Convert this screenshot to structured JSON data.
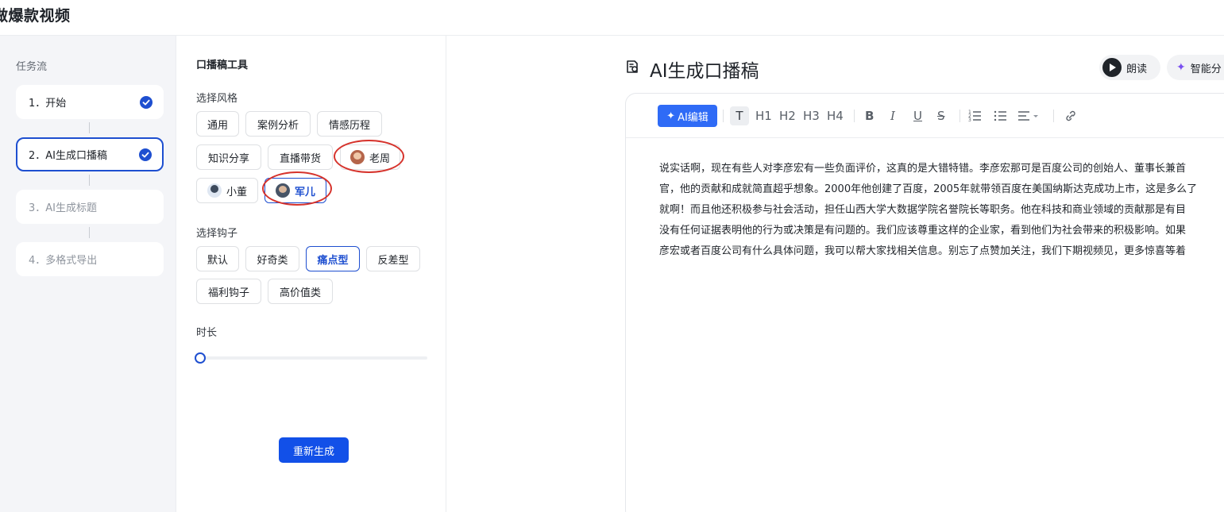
{
  "header": {
    "title": "做爆款视频"
  },
  "taskflow": {
    "title": "任务流",
    "steps": [
      {
        "label": "1．开始",
        "status": "done"
      },
      {
        "label": "2．AI生成口播稿",
        "status": "active"
      },
      {
        "label": "3．AI生成标题",
        "status": "pending"
      },
      {
        "label": "4．多格式导出",
        "status": "pending"
      }
    ]
  },
  "tool": {
    "title": "口播稿工具",
    "style_label": "选择风格",
    "styles": [
      "通用",
      "案例分析",
      "情感历程",
      "知识分享",
      "直播带货",
      "老周",
      "小董",
      "军儿"
    ],
    "hook_label": "选择钩子",
    "hooks": [
      "默认",
      "好奇类",
      "痛点型",
      "反差型",
      "福利钩子",
      "高价值类"
    ],
    "selected_style": "军儿",
    "selected_hook": "痛点型",
    "duration_label": "时长",
    "duration_value": 0,
    "regen_label": "重新生成"
  },
  "editor": {
    "title": "AI生成口播稿",
    "read_label": "朗读",
    "smart_label": "智能分",
    "ai_edit_label": "AI编辑",
    "toolbar": [
      "T",
      "H1",
      "H2",
      "H3",
      "H4",
      "B",
      "I",
      "U",
      "S",
      "ordered-list",
      "bullet-list",
      "align",
      "link"
    ],
    "body_lines": [
      "说实话啊，现在有些人对李彦宏有一些负面评价，这真的是大错特错。李彦宏那可是百度公司的创始人、董事长兼首",
      "官，他的贡献和成就简直超乎想象。2000年他创建了百度，2005年就带领百度在美国纳斯达克成功上市，这是多么了",
      "就啊！而且他还积极参与社会活动，担任山西大学大数据学院名誉院长等职务。他在科技和商业领域的贡献那是有目",
      "没有任何证据表明他的行为或决策是有问题的。我们应该尊重这样的企业家，看到他们为社会带来的积极影响。如果",
      "彦宏或者百度公司有什么具体问题，我可以帮大家找相关信息。别忘了点赞加关注，我们下期视频见，更多惊喜等着"
    ]
  },
  "colors": {
    "accent": "#1e4fd0",
    "primary_button": "#1250e8",
    "annotation": "#d6332c"
  }
}
